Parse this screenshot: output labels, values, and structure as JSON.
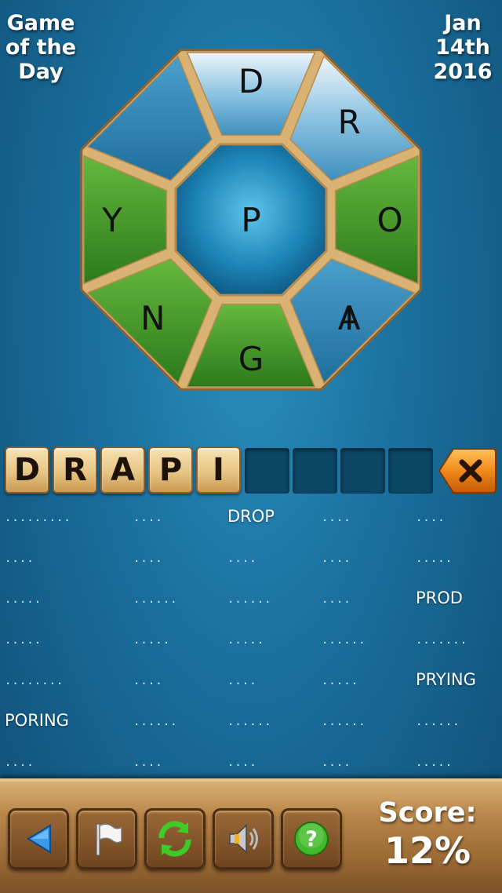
{
  "header": {
    "title_lines": [
      "Game",
      "of the",
      "Day"
    ],
    "date_lines": [
      "Jan",
      "14th",
      "2016"
    ]
  },
  "wheel": {
    "center": "P",
    "outer": [
      {
        "letter": "D",
        "state": "blue"
      },
      {
        "letter": "R",
        "state": "blue"
      },
      {
        "letter": "O",
        "state": "green"
      },
      {
        "letter": "I",
        "state": "blue"
      },
      {
        "letter": "G",
        "state": "green"
      },
      {
        "letter": "N",
        "state": "green"
      },
      {
        "letter": "Y",
        "state": "green"
      },
      {
        "letter": "A",
        "state": "blue"
      }
    ],
    "colors": {
      "blue": "#5aa6cf",
      "green": "#3f9a2a",
      "center": "#1d86b8",
      "frame": "#d9b274"
    }
  },
  "current_word": {
    "letters": [
      "D",
      "R",
      "A",
      "P",
      "I"
    ],
    "empty_slots": 4
  },
  "answers": {
    "rows": [
      [
        {
          "mask": ".........",
          "found": false
        },
        {
          "mask": "....",
          "found": false
        },
        {
          "word": "DROP",
          "found": true
        },
        {
          "mask": "....",
          "found": false
        },
        {
          "mask": "....",
          "found": false
        }
      ],
      [
        {
          "mask": "....",
          "found": false
        },
        {
          "mask": "....",
          "found": false
        },
        {
          "mask": "....",
          "found": false
        },
        {
          "mask": "....",
          "found": false
        },
        {
          "mask": ".....",
          "found": false
        }
      ],
      [
        {
          "mask": ".....",
          "found": false
        },
        {
          "mask": "......",
          "found": false
        },
        {
          "mask": "......",
          "found": false
        },
        {
          "mask": "....",
          "found": false
        },
        {
          "word": "PROD",
          "found": true
        }
      ],
      [
        {
          "mask": ".....",
          "found": false
        },
        {
          "mask": ".....",
          "found": false
        },
        {
          "mask": ".....",
          "found": false
        },
        {
          "mask": "......",
          "found": false
        },
        {
          "mask": ".......",
          "found": false
        }
      ],
      [
        {
          "mask": "........",
          "found": false
        },
        {
          "mask": "....",
          "found": false
        },
        {
          "mask": "....",
          "found": false
        },
        {
          "mask": ".....",
          "found": false
        },
        {
          "word": "PRYING",
          "found": true
        }
      ],
      [
        {
          "word": "PORING",
          "found": true
        },
        {
          "mask": "......",
          "found": false
        },
        {
          "mask": "......",
          "found": false
        },
        {
          "mask": "......",
          "found": false
        },
        {
          "mask": "......",
          "found": false
        }
      ],
      [
        {
          "mask": "....",
          "found": false
        },
        {
          "mask": "....",
          "found": false
        },
        {
          "mask": "....",
          "found": false
        },
        {
          "mask": "....",
          "found": false
        },
        {
          "mask": ".....",
          "found": false
        }
      ]
    ]
  },
  "toolbar": {
    "buttons": [
      "back-icon",
      "flag-icon",
      "refresh-icon",
      "speaker-icon",
      "help-icon"
    ],
    "score_label": "Score:",
    "score_value": "12%"
  }
}
